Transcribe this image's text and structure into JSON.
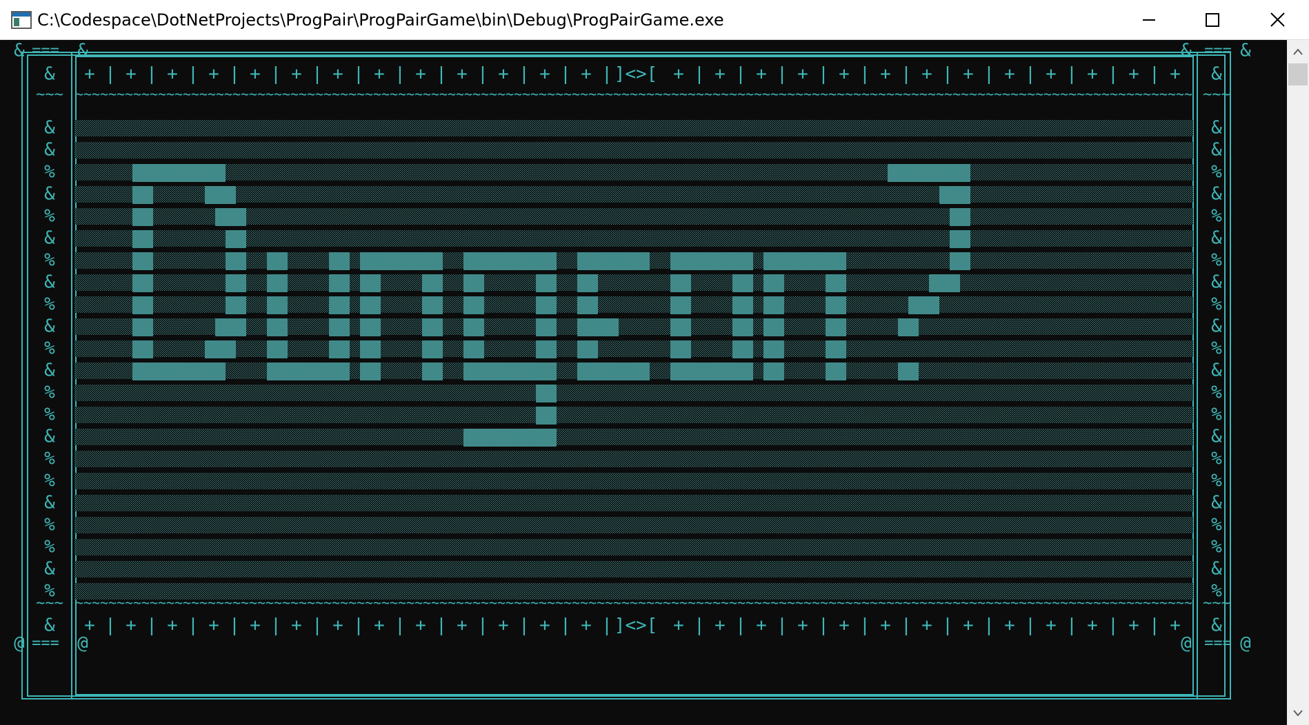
{
  "window": {
    "title": "C:\\Codespace\\DotNetProjects\\ProgPair\\ProgPairGame\\bin\\Debug\\ProgPairGame.exe"
  },
  "colors": {
    "ascii_art": "#3fb7b7",
    "border": "#3fb7b7",
    "background": "#0c0c0c"
  },
  "console": {
    "top_border": "&╗===╔&",
    "bottom_border": "@╝===╚@",
    "hud_label": "]<>[",
    "hud_cell": "+",
    "hud_separator": "|",
    "wave_cell": "~~~",
    "side_symbols": [
      "&",
      "&",
      "%",
      "&",
      "%",
      "&",
      "%",
      "&",
      "%",
      "&",
      "%",
      "&",
      "%",
      "%",
      "&",
      "%",
      "%",
      "&",
      "%",
      "%",
      "&",
      "%"
    ],
    "logo_word": "Dungeon"
  }
}
